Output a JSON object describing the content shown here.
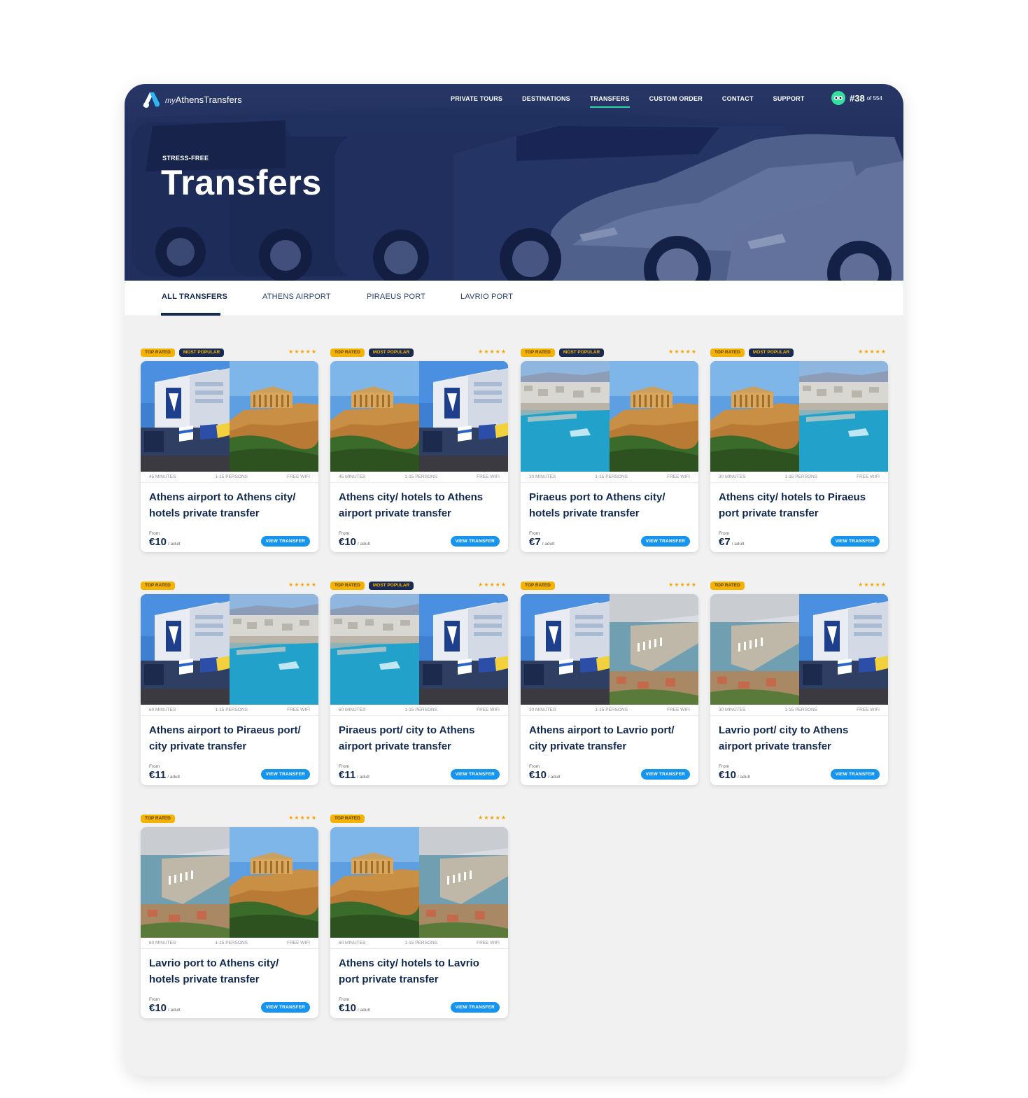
{
  "brand": {
    "prefix": "my",
    "name": "AthensTransfers"
  },
  "nav": [
    {
      "label": "PRIVATE TOURS",
      "active": false
    },
    {
      "label": "DESTINATIONS",
      "active": false
    },
    {
      "label": "TRANSFERS",
      "active": true
    },
    {
      "label": "CUSTOM ORDER",
      "active": false
    },
    {
      "label": "CONTACT",
      "active": false
    },
    {
      "label": "SUPPORT",
      "active": false
    }
  ],
  "rank": {
    "number": "#38",
    "of": "of 554"
  },
  "hero": {
    "kicker": "STRESS-FREE",
    "title": "Transfers"
  },
  "tabs": [
    "ALL TRANSFERS",
    "ATHENS AIRPORT",
    "PIRAEUS PORT",
    "LAVRIO PORT"
  ],
  "colors": {
    "accent": "#1595f0",
    "navy": "#12294f",
    "badge_top": "#f5b301",
    "badge_popular": "#1a2b53",
    "nav_active": "#2fd3a4"
  },
  "cards": [
    {
      "badges": [
        "TOP RATED",
        "MOST POPULAR"
      ],
      "stars": "★★★★★",
      "images": [
        "airport",
        "acropolis"
      ],
      "duration": "45 MINUTES",
      "persons": "1-15 PERSONS",
      "wifi": "FREE WIFI",
      "title": "Athens airport to Athens city/ hotels private transfer",
      "from": "From",
      "price": "€10",
      "unit": "/ adult",
      "button": "VIEW TRANSFER"
    },
    {
      "badges": [
        "TOP RATED",
        "MOST POPULAR"
      ],
      "stars": "★★★★★",
      "images": [
        "acropolis",
        "airport"
      ],
      "duration": "45 MINUTES",
      "persons": "1-15 PERSONS",
      "wifi": "FREE WIFI",
      "title": "Athens city/ hotels to Athens airport private transfer",
      "from": "From",
      "price": "€10",
      "unit": "/ adult",
      "button": "VIEW TRANSFER"
    },
    {
      "badges": [
        "TOP RATED",
        "MOST POPULAR"
      ],
      "stars": "★★★★★",
      "images": [
        "piraeus",
        "acropolis"
      ],
      "duration": "30 MINUTES",
      "persons": "1-15 PERSONS",
      "wifi": "FREE WIFI",
      "title": "Piraeus port to Athens city/ hotels private transfer",
      "from": "From",
      "price": "€7",
      "unit": "/ adult",
      "button": "VIEW TRANSFER"
    },
    {
      "badges": [
        "TOP RATED",
        "MOST POPULAR"
      ],
      "stars": "★★★★★",
      "images": [
        "acropolis",
        "piraeus"
      ],
      "duration": "30 MINUTES",
      "persons": "1-15 PERSONS",
      "wifi": "FREE WIFI",
      "title": "Athens city/ hotels to Piraeus port private transfer",
      "from": "From",
      "price": "€7",
      "unit": "/ adult",
      "button": "VIEW TRANSFER"
    },
    {
      "badges": [
        "TOP RATED"
      ],
      "stars": "★★★★★",
      "images": [
        "airport",
        "piraeus"
      ],
      "duration": "60 MINUTES",
      "persons": "1-15 PERSONS",
      "wifi": "FREE WIFI",
      "title": "Athens airport to Piraeus port/ city private transfer",
      "from": "From",
      "price": "€11",
      "unit": "/ adult",
      "button": "VIEW TRANSFER"
    },
    {
      "badges": [
        "TOP RATED",
        "MOST POPULAR"
      ],
      "stars": "★★★★★",
      "images": [
        "piraeus",
        "airport"
      ],
      "duration": "60 MINUTES",
      "persons": "1-15 PERSONS",
      "wifi": "FREE WIFI",
      "title": "Piraeus port/ city to Athens airport private transfer",
      "from": "From",
      "price": "€11",
      "unit": "/ adult",
      "button": "VIEW TRANSFER"
    },
    {
      "badges": [
        "TOP RATED"
      ],
      "stars": "★★★★★",
      "images": [
        "airport",
        "lavrio"
      ],
      "duration": "30 MINUTES",
      "persons": "1-15 PERSONS",
      "wifi": "FREE WIFI",
      "title": "Athens airport to Lavrio port/ city private transfer",
      "from": "From",
      "price": "€10",
      "unit": "/ adult",
      "button": "VIEW TRANSFER"
    },
    {
      "badges": [
        "TOP RATED"
      ],
      "stars": "★★★★★",
      "images": [
        "lavrio",
        "airport"
      ],
      "duration": "30 MINUTES",
      "persons": "1-15 PERSONS",
      "wifi": "FREE WIFI",
      "title": "Lavrio port/ city to Athens airport private transfer",
      "from": "From",
      "price": "€10",
      "unit": "/ adult",
      "button": "VIEW TRANSFER"
    },
    {
      "badges": [
        "TOP RATED"
      ],
      "stars": "★★★★★",
      "images": [
        "lavrio",
        "acropolis"
      ],
      "duration": "60 MINUTES",
      "persons": "1-15 PERSONS",
      "wifi": "FREE WIFI",
      "title": "Lavrio port to Athens city/ hotels private transfer",
      "from": "From",
      "price": "€10",
      "unit": "/ adult",
      "button": "VIEW TRANSFER"
    },
    {
      "badges": [
        "TOP RATED"
      ],
      "stars": "★★★★★",
      "images": [
        "acropolis",
        "lavrio"
      ],
      "duration": "60 MINUTES",
      "persons": "1-15 PERSONS",
      "wifi": "FREE WIFI",
      "title": "Athens city/ hotels to Lavrio port private transfer",
      "from": "From",
      "price": "€10",
      "unit": "/ adult",
      "button": "VIEW TRANSFER"
    }
  ]
}
